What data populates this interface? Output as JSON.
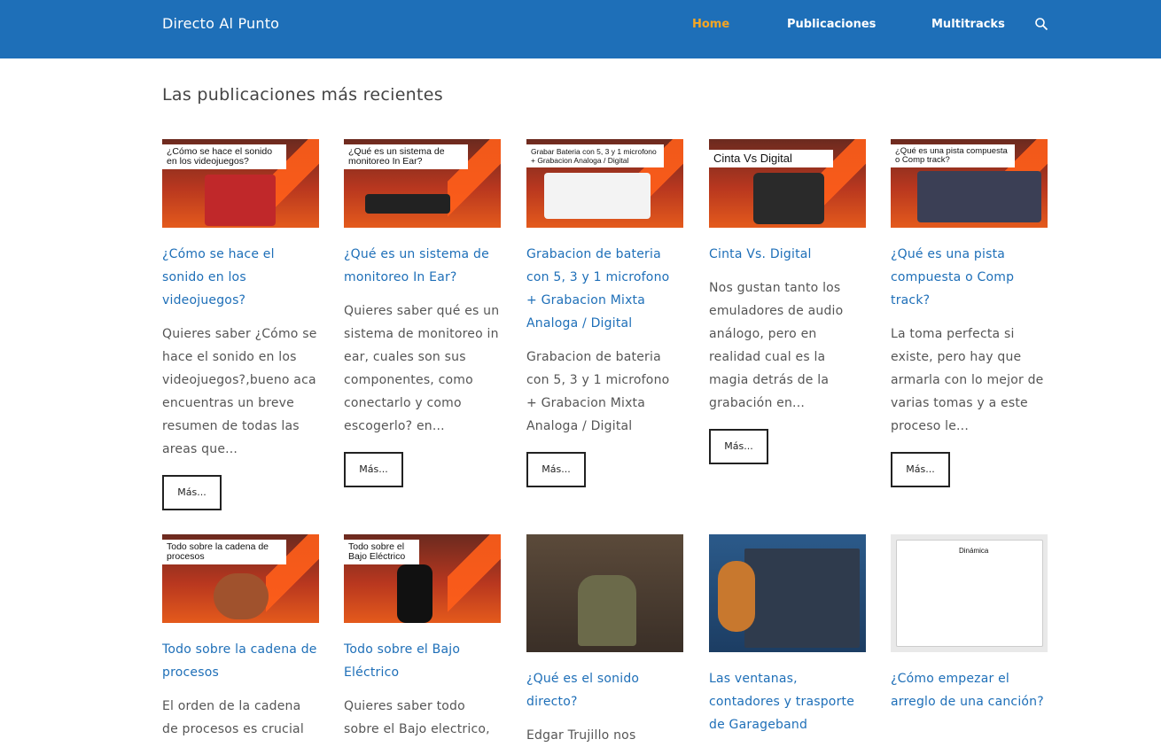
{
  "header": {
    "brand": "Directo Al Punto",
    "nav": [
      {
        "label": "Home",
        "active": true
      },
      {
        "label": "Publicaciones",
        "active": false
      },
      {
        "label": "Multitracks",
        "active": false
      }
    ],
    "search_icon": "search-icon"
  },
  "main": {
    "section_title": "Las publicaciones más recientes",
    "more_label": "Más...",
    "posts": [
      {
        "thumb_text": "¿Cómo se hace el sonido en los videojuegos?",
        "title": "¿Cómo se hace el sonido en los videojuegos?",
        "excerpt": "Quieres saber ¿Cómo se hace el sonido en los videojuegos?,bueno aca encuentras un breve resumen de todas las areas que..."
      },
      {
        "thumb_text": "¿Qué es un sistema de monitoreo In Ear?",
        "title": "¿Qué es un sistema de monitoreo In Ear?",
        "excerpt": "Quieres saber qué es un sistema de monitoreo in ear, cuales son sus componentes, como conectarlo y como escogerlo? en..."
      },
      {
        "thumb_text": "Grabar Bateria con 5, 3 y 1 microfono + Grabacion Analoga / Digital",
        "title": "Grabacion de bateria con 5, 3 y 1 microfono + Grabacion Mixta Analoga / Digital",
        "excerpt": "Grabacion de bateria con 5, 3 y 1 microfono + Grabacion Mixta Analoga / Digital"
      },
      {
        "thumb_text": "Cinta Vs Digital",
        "title": "Cinta Vs. Digital",
        "excerpt": "Nos gustan tanto los emuladores de audio análogo, pero en realidad cual es la magia detrás de la grabación en..."
      },
      {
        "thumb_text": "¿Qué es una pista compuesta o Comp track?",
        "title": "¿Qué es una pista compuesta o Comp track?",
        "excerpt": "La toma perfecta si existe, pero hay que armarla con lo mejor de varias tomas y a este proceso le..."
      },
      {
        "thumb_text": "Todo sobre la cadena de procesos",
        "title": "Todo sobre la cadena de procesos",
        "excerpt": "El orden de la cadena de procesos es crucial"
      },
      {
        "thumb_text": "Todo sobre el Bajo Eléctrico",
        "title": "Todo sobre el Bajo Eléctrico",
        "excerpt": "Quieres saber todo sobre el Bajo electrico,"
      },
      {
        "thumb_text": "",
        "title": "¿Qué es el sonido directo?",
        "excerpt": "Edgar Trujillo nos"
      },
      {
        "thumb_text": "",
        "title": "Las ventanas, contadores y trasporte de Garageband",
        "excerpt": ""
      },
      {
        "thumb_text": "Dinámica",
        "title": "¿Cómo empezar el arreglo de una canción?",
        "excerpt": ""
      }
    ]
  },
  "colors": {
    "header_bg": "#1e6fb8",
    "nav_active": "#f5a623",
    "link": "#1e6fb8"
  }
}
